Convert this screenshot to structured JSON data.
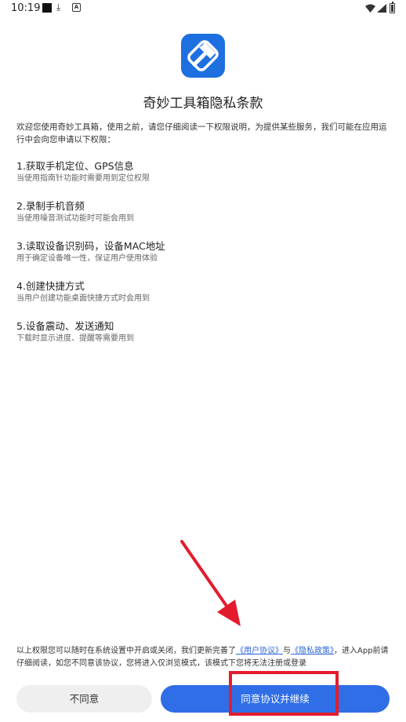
{
  "status_bar": {
    "time": "10:19",
    "left_icons": [
      "notification-square-icon",
      "download-icon",
      "font-a-icon"
    ],
    "right_icons": [
      "wifi-icon",
      "signal-icon",
      "battery-icon"
    ],
    "battery_level": 0.85
  },
  "app": {
    "logo_icon": "hammer-tool-icon",
    "brand_color": "#1e6fe0"
  },
  "dialog": {
    "title": "奇妙工具箱隐私条款",
    "intro": "欢迎您使用奇妙工具箱，使用之前，请您仔细阅读一下权限说明，为提供某些服务，我们可能在应用运行中会向您申请以下权限：",
    "permissions": [
      {
        "title": "1.获取手机定位、GPS信息",
        "desc": "当使用指南针功能时需要用到定位权限"
      },
      {
        "title": "2.录制手机音频",
        "desc": "当使用噪音测试功能时可能会用到"
      },
      {
        "title": "3.读取设备识别码，设备MAC地址",
        "desc": "用于确定设备唯一性，保证用户使用体验"
      },
      {
        "title": "4.创建快捷方式",
        "desc": "当用户创建功能桌面快捷方式时会用到"
      },
      {
        "title": "5.设备震动、发送通知",
        "desc": "下载时显示进度、提醒等需要用到"
      }
    ],
    "notice": {
      "part1": "以上权限您可以随时在系统设置中开启或关闭，我们更新完善了",
      "link_user_agreement": "《用户协议》",
      "part2": "与",
      "link_privacy_policy": "《隐私政策》",
      "part3": "，进入App前请仔细阅读，如您不同意该协议，您将进入仅浏览模式，该模式下您将无法注册或登录"
    },
    "decline_label": "不同意",
    "agree_label": "同意协议并继续"
  },
  "colors": {
    "accent": "#2f6ee6",
    "link": "#2c66d8",
    "annotation_red": "#e31c2d"
  }
}
